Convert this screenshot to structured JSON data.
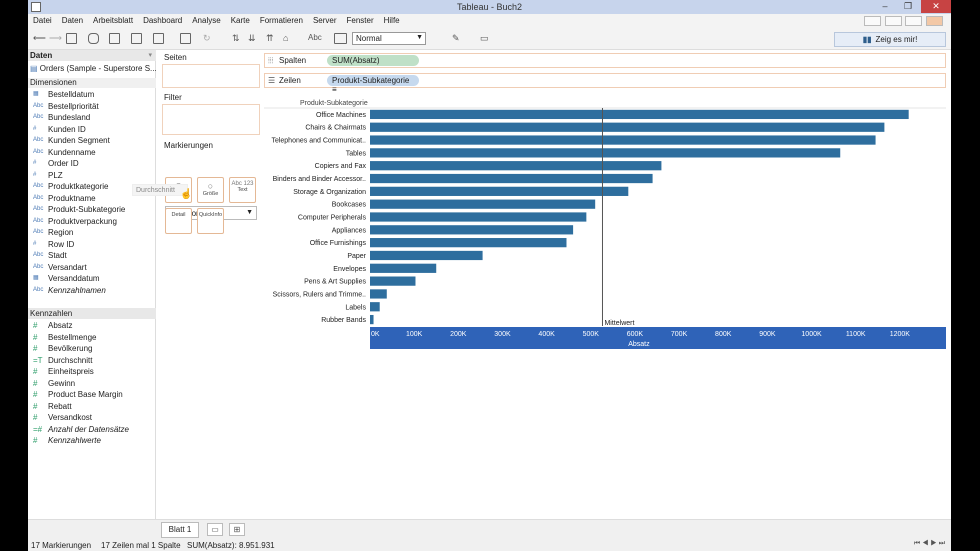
{
  "window": {
    "title": "Tableau - Buch2"
  },
  "menu": [
    "Datei",
    "Daten",
    "Arbeitsblatt",
    "Dashboard",
    "Analyse",
    "Karte",
    "Formatieren",
    "Server",
    "Fenster",
    "Hilfe"
  ],
  "toolbar": {
    "text_label": "Abc",
    "format_value": "Normal",
    "show_me": "Zeig es mir!"
  },
  "data_pane": {
    "header": "Daten",
    "datasource": "Orders (Sample - Superstore S...",
    "dimensions_header": "Dimensionen",
    "dimensions": [
      {
        "icon": "cal",
        "label": "Bestelldatum"
      },
      {
        "icon": "Abc",
        "label": "Bestellpriorität"
      },
      {
        "icon": "Abc",
        "label": "Bundesland"
      },
      {
        "icon": "#",
        "label": "Kunden ID"
      },
      {
        "icon": "Abc",
        "label": "Kunden Segment"
      },
      {
        "icon": "Abc",
        "label": "Kundenname"
      },
      {
        "icon": "#",
        "label": "Order ID"
      },
      {
        "icon": "#",
        "label": "PLZ"
      },
      {
        "icon": "Abc",
        "label": "Produktkategorie"
      },
      {
        "icon": "Abc",
        "label": "Produktname"
      },
      {
        "icon": "Abc",
        "label": "Produkt-Subkategorie"
      },
      {
        "icon": "Abc",
        "label": "Produktverpackung"
      },
      {
        "icon": "Abc",
        "label": "Region"
      },
      {
        "icon": "#",
        "label": "Row ID"
      },
      {
        "icon": "Abc",
        "label": "Stadt"
      },
      {
        "icon": "Abc",
        "label": "Versandart"
      },
      {
        "icon": "cal",
        "label": "Versanddatum"
      },
      {
        "icon": "Abc",
        "label": "Kennzahlnamen",
        "italic": true
      }
    ],
    "measures_header": "Kennzahlen",
    "measures": [
      {
        "icon": "#",
        "label": "Absatz"
      },
      {
        "icon": "#",
        "label": "Bestellmenge"
      },
      {
        "icon": "#",
        "label": "Bevölkerung"
      },
      {
        "icon": "=T",
        "label": "Durchschnitt"
      },
      {
        "icon": "#",
        "label": "Einheitspreis"
      },
      {
        "icon": "#",
        "label": "Gewinn"
      },
      {
        "icon": "#",
        "label": "Product Base Margin"
      },
      {
        "icon": "#",
        "label": "Rebatt"
      },
      {
        "icon": "#",
        "label": "Versandkost"
      },
      {
        "icon": "=#",
        "label": "Anzahl der Datensätze",
        "italic": true
      },
      {
        "icon": "#",
        "label": "Kennzahlwerte",
        "italic": true
      }
    ]
  },
  "cards": {
    "pages": "Seiten",
    "filter": "Filter",
    "marks": "Markierungen",
    "mark_type": "Automatisch",
    "mark_buttons": [
      "Farbe",
      "Größe",
      "Text",
      "Detail",
      "QuickInfo"
    ],
    "mark_text_icon": "Abc 123",
    "drag_tooltip": "Durchschnitt"
  },
  "shelves": {
    "columns_label": "Spalten",
    "columns_pill": "SUM(Absatz)",
    "rows_label": "Zeilen",
    "rows_pill": "Produkt-Subkategorie"
  },
  "chart_data": {
    "type": "bar",
    "orientation": "horizontal",
    "row_header": "Produkt-Subkategorie",
    "categories": [
      "Office Machines",
      "Chairs & Chairmats",
      "Telephones and Communicat..",
      "Tables",
      "Copiers and Fax",
      "Binders and Binder Accessor..",
      "Storage & Organization",
      "Bookcases",
      "Computer Peripherals",
      "Appliances",
      "Office Furnishings",
      "Paper",
      "Envelopes",
      "Pens & Art Supplies",
      "Scissors, Rulers and Trimme..",
      "Labels",
      "Rubber Bands"
    ],
    "values": [
      1220000,
      1165000,
      1145000,
      1065000,
      660000,
      640000,
      585000,
      510000,
      490000,
      460000,
      445000,
      255000,
      150000,
      103000,
      38000,
      22000,
      8000
    ],
    "xlabel": "Absatz",
    "xlim": [
      0,
      1300000
    ],
    "xticks": [
      "0K",
      "100K",
      "200K",
      "300K",
      "400K",
      "500K",
      "600K",
      "700K",
      "800K",
      "900K",
      "1000K",
      "1100K",
      "1200K"
    ],
    "reference_line": {
      "value": 526525,
      "label": "Mittelwert"
    },
    "bar_color": "#2e6e9e",
    "axis_color": "#2f63b8"
  },
  "tabs": {
    "sheet": "Blatt 1"
  },
  "status": {
    "marks": "17 Markierungen",
    "dims": "17 Zeilen mal 1 Spalte",
    "sum": "SUM(Absatz): 8.951.931"
  }
}
